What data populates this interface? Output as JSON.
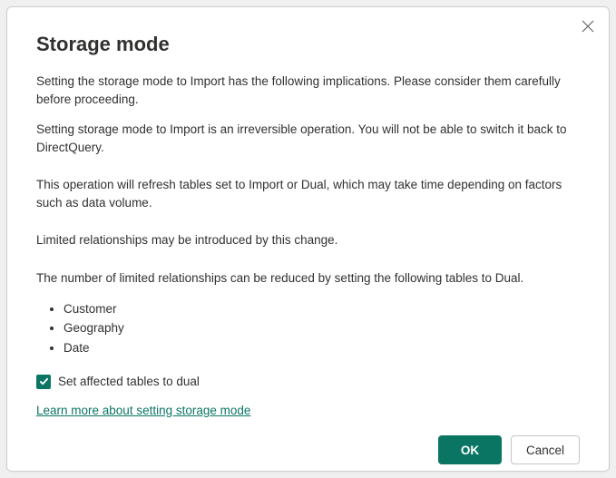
{
  "dialog": {
    "title": "Storage mode",
    "paragraphs": {
      "intro": "Setting the storage mode to Import has the following implications. Please consider them carefully before proceeding.",
      "irreversible": "Setting storage mode to Import is an irreversible operation.  You will not be able to switch it back to DirectQuery.",
      "refresh": "This operation will refresh tables set to Import or Dual, which may take time depending on factors such as data volume.",
      "limited": "Limited relationships may be introduced by this change.",
      "reduce": "The number of limited relationships can be reduced by setting the following tables to Dual."
    },
    "tables": [
      "Customer",
      "Geography",
      "Date"
    ],
    "checkbox_label": "Set affected tables to dual",
    "link_label": "Learn more about setting storage mode",
    "buttons": {
      "ok": "OK",
      "cancel": "Cancel"
    }
  }
}
